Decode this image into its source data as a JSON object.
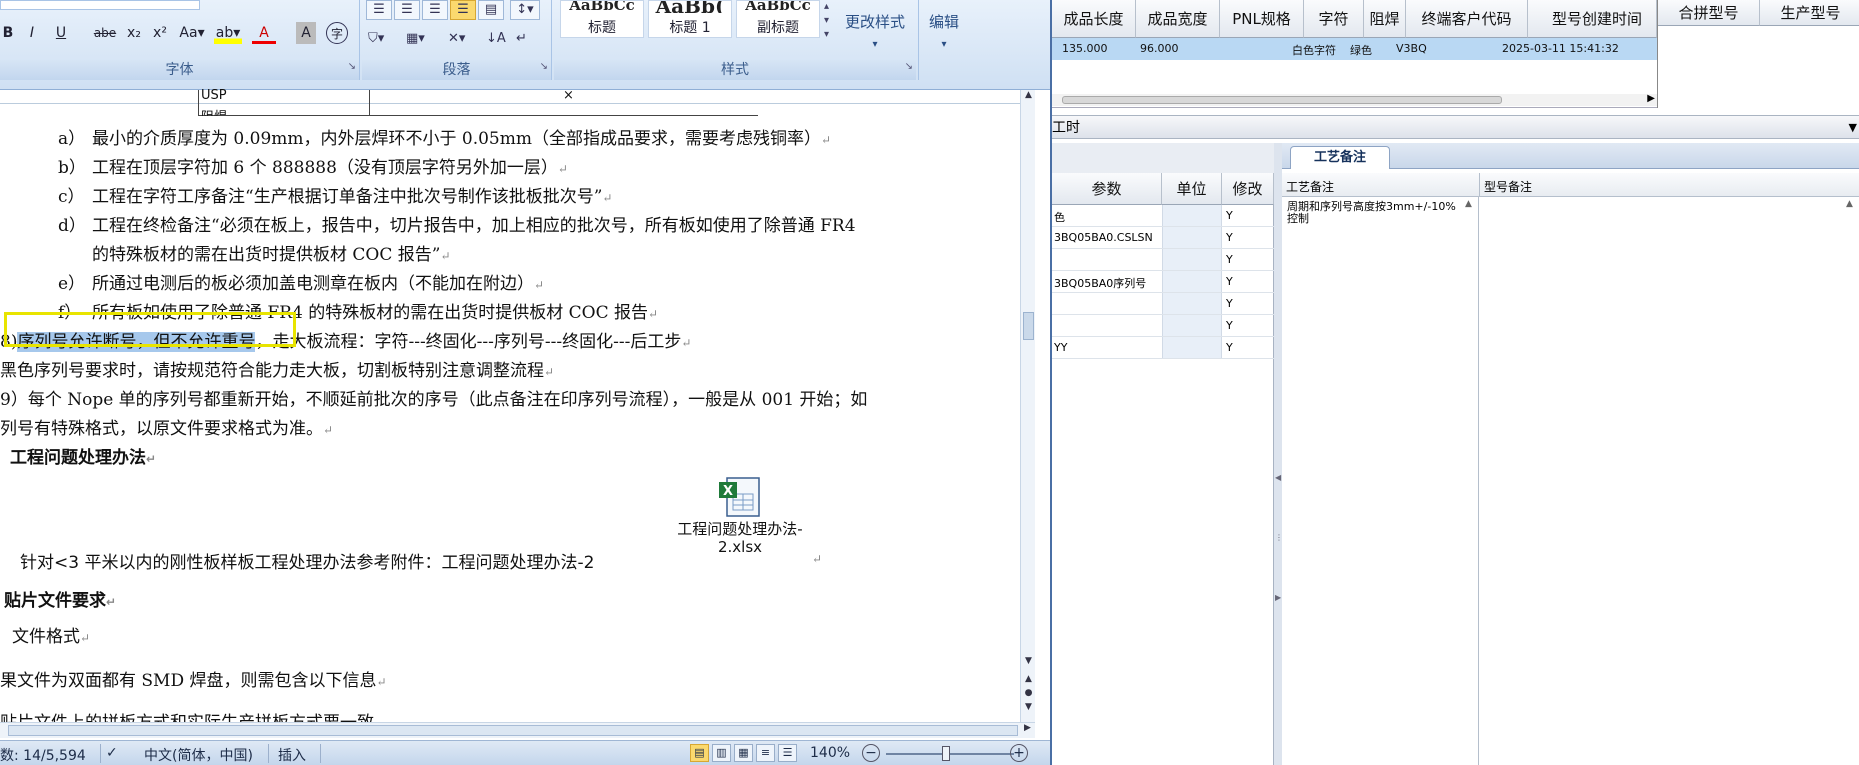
{
  "ribbon": {
    "font_group": {
      "label": "字体",
      "buttons": [
        "B",
        "I",
        "U",
        "abe",
        "x₂",
        "x²",
        "Aa▾",
        "A",
        "A",
        "A"
      ]
    },
    "paragraph_group": {
      "label": "段落"
    },
    "styles_group": {
      "label": "样式",
      "styles": [
        {
          "sample": "AaBbCc",
          "name": "标题"
        },
        {
          "sample": "AaBb(",
          "name": "标题 1"
        },
        {
          "sample": "AaBbCc",
          "name": "副标题"
        }
      ],
      "change_styles": "更改样式",
      "edit": "编辑"
    }
  },
  "document": {
    "table_fragment": [
      "USP",
      "×",
      "阻焊"
    ],
    "items": [
      {
        "label": "a）",
        "text": "最小的介质厚度为 0.09mm，内外层焊环不小于 0.05mm（全部指成品要求，需要考虑残铜率）"
      },
      {
        "label": "b）",
        "text": "工程在顶层字符加 6 个 888888（没有顶层字符另外加一层）"
      },
      {
        "label": "c）",
        "text": "工程在字符工序备注“生产根据订单备注中批次号制作该批板批次号”"
      },
      {
        "label": "d）",
        "text": "工程在终检备注“必须在板上，报告中，切片报告中，加上相应的批次号，所有板如使用了除普通 FR4"
      },
      {
        "label": "",
        "text": "的特殊板材的需在出货时提供板材 COC 报告”"
      },
      {
        "label": "e）",
        "text": "所通过电测后的板必须加盖电测章在板内（不能加在附边）"
      },
      {
        "label": "f）",
        "text": "所有板如使用了除普通 FR4 的特殊板材的需在出货时提供板材 COC 报告"
      }
    ],
    "item8_prefix": "8)",
    "item8_highlight": "序列号允许断号，但不允许重号",
    "item8_rest": "，走大板流程：字符---终固化---序列号---终固化---后工步",
    "black_serial": "黑色序列号要求时，请按规范符合能力走大板，切割板特别注意调整流程",
    "item9_line1": "9）每个 Nope 单的序列号都重新开始，不顺延前批次的序号（此点备注在印序列号流程），一般是从 001 开始；如",
    "item9_line2": "列号有特殊格式，以原文件要求格式为准。",
    "heading_issues": "工程问题处理办法",
    "attachment_name_line1": "工程问题处理办法-",
    "attachment_name_line2": "2.xlsx",
    "reference_line": "针对<3 平米以内的刚性板样板工程处理办法参考附件：工程问题处理办法-2",
    "heading_smd": "贴片文件要求",
    "file_format": "文件格式",
    "smd_line": "果文件为双面都有 SMD 焊盘，则需包含以下信息",
    "last_line": "贴片文件上的拼板方式和实际生产拼板方式要一致"
  },
  "statusbar": {
    "word_count": "数: 14/5,594",
    "language": "中文(简体，中国)",
    "insert_mode": "插入",
    "zoom": "140%"
  },
  "erp": {
    "top_headers": [
      "成品长度",
      "成品宽度",
      "PNL规格",
      "字符",
      "阻焊",
      "终端客户代码",
      "型号创建时间"
    ],
    "top_row": {
      "length": "135.000",
      "width": "96.000",
      "pnl": "",
      "char": "白色字符",
      "mask": "绿色",
      "customer": "V3BQ",
      "created": "2025-03-11 15:41:32"
    },
    "merge_headers": [
      "合拼型号",
      "生产型号"
    ],
    "bar_label": "工时",
    "param_headers": [
      "参数",
      "单位",
      "修改"
    ],
    "param_rows": [
      {
        "param": "色",
        "unit": "",
        "mod": "Y"
      },
      {
        "param": "3BQ05BA0.CSLSN",
        "unit": "",
        "mod": "Y"
      },
      {
        "param": "",
        "unit": "",
        "mod": "Y"
      },
      {
        "param": "3BQ05BA0序列号",
        "unit": "",
        "mod": "Y"
      },
      {
        "param": "",
        "unit": "",
        "mod": "Y"
      },
      {
        "param": "",
        "unit": "",
        "mod": "Y"
      },
      {
        "param": "YY",
        "unit": "",
        "mod": "Y"
      }
    ],
    "tab_label": "工艺备注",
    "note_headers": [
      "工艺备注",
      "型号备注"
    ],
    "process_note": "周期和序列号高度按3mm+/-10%控制"
  }
}
